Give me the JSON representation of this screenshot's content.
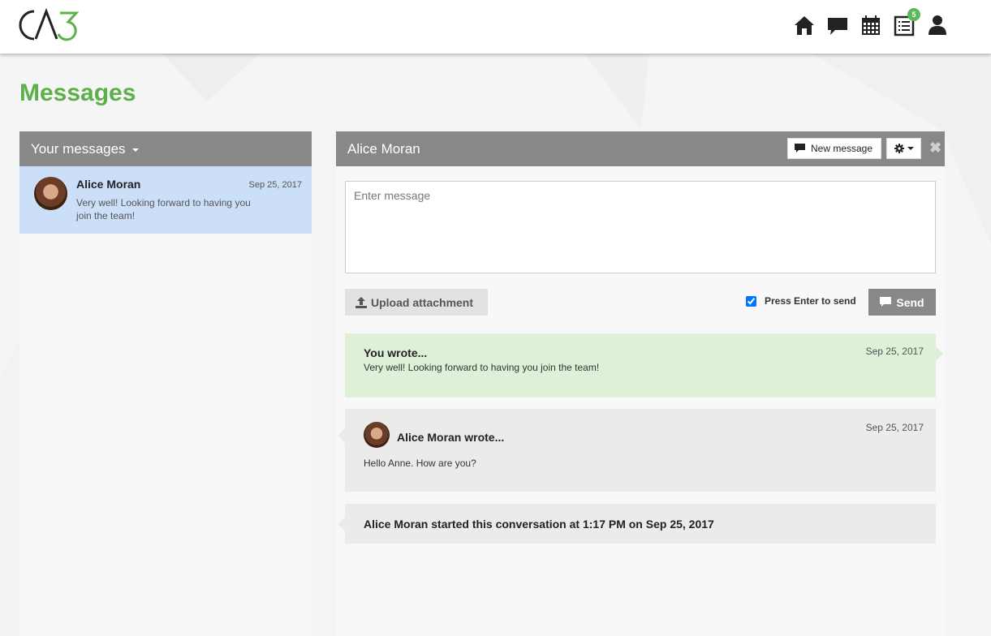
{
  "header": {
    "logo_text": "CA3",
    "notification_count": "5",
    "icons": [
      "home-icon",
      "chat-icon",
      "calendar-icon",
      "list-icon",
      "user-icon"
    ]
  },
  "page": {
    "title": "Messages"
  },
  "sidebar": {
    "heading": "Your messages",
    "conversations": [
      {
        "name": "Alice Moran",
        "date": "Sep 25, 2017",
        "preview": "Very well! Looking forward to having you join the team!"
      }
    ]
  },
  "conversation": {
    "title": "Alice Moran",
    "new_message_label": "New message",
    "input_placeholder": "Enter message",
    "upload_label": "Upload attachment",
    "enter_to_send_label": "Press Enter to send",
    "enter_to_send_checked": true,
    "send_label": "Send",
    "messages": [
      {
        "author": "You wrote...",
        "date": "Sep 25, 2017",
        "text": "Very well! Looking forward to having you join the team!"
      },
      {
        "author": "Alice Moran wrote...",
        "date": "Sep 25, 2017",
        "text": "Hello Anne. How are you?"
      }
    ],
    "started_note": "Alice Moran started this conversation at 1:17 PM on Sep 25, 2017"
  },
  "colors": {
    "accent_green": "#5cb04a",
    "header_gray": "#888888",
    "selected_conv": "#ccdff8",
    "own_message": "#dff0d8",
    "badge": "#5cb85c"
  }
}
